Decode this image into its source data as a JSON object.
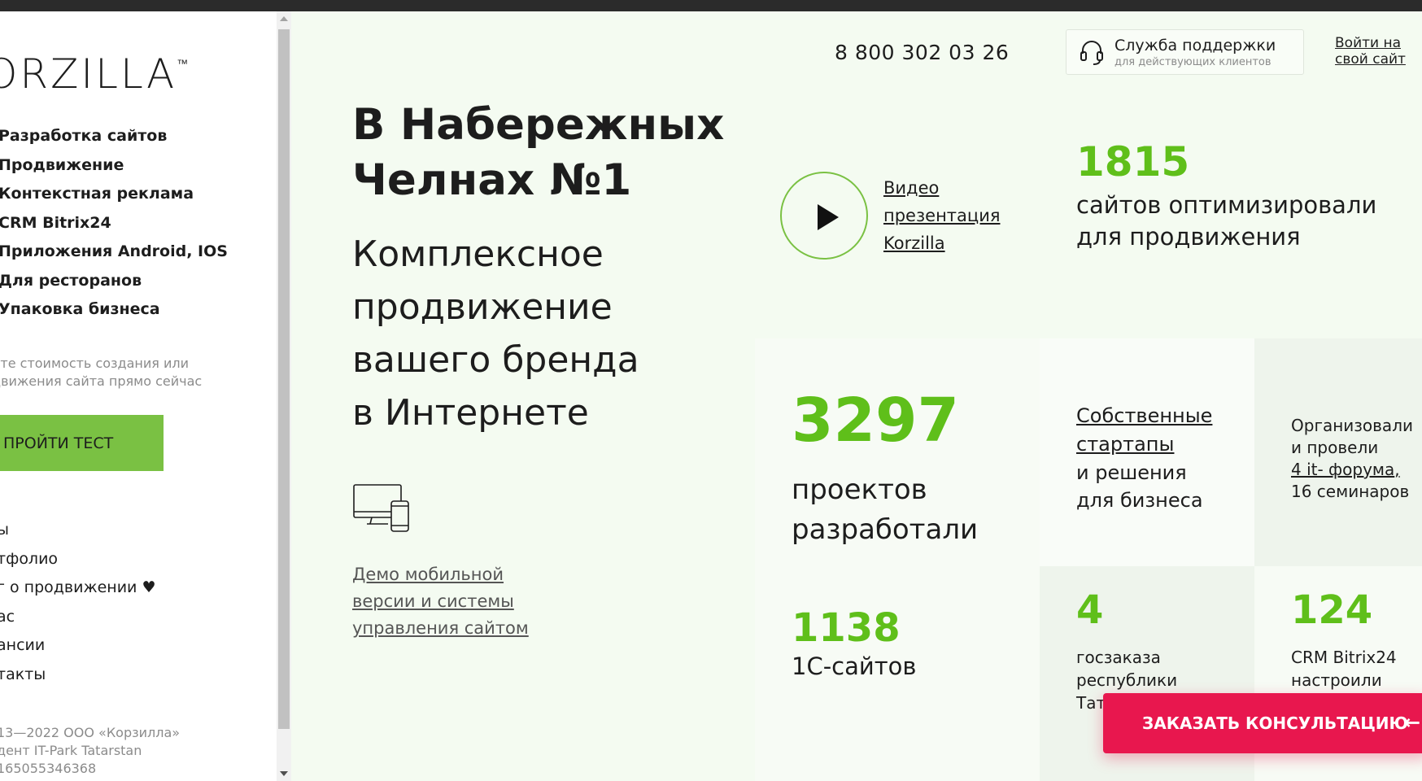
{
  "sidebar": {
    "logo": "ORZILLA",
    "logo_tm": "™",
    "menu": [
      "Разработка сайтов",
      "Продвижение",
      "Контекстная реклама",
      "CRM Bitrix24",
      "Приложения Android, IOS",
      "Для ресторанов",
      "Упаковка бизнеса"
    ],
    "promo_line1": "йте стоимость создания или",
    "promo_line2": "движения сайта прямо сейчас",
    "test_button": "ПРОЙТИ ТЕСТ",
    "menu2": [
      "ы",
      "тфолио",
      "г о продвижении ♥",
      "ас",
      "ансии",
      "такты"
    ],
    "footer_line1": "13—2022 ООО «Корзилла»",
    "footer_line2": "дент IT-Park Tatarstan",
    "footer_line3": "165055346368"
  },
  "header": {
    "phone": "8 800 302 03 26",
    "support_title": "Служба поддержки",
    "support_sub": "для действующих клиентов",
    "login_line1": "Войти на",
    "login_line2": "свой сайт"
  },
  "hero": {
    "headline_line1": "В Набережных",
    "headline_line2": "Челнах №1",
    "sub_line1": "Комплексное",
    "sub_line2": "продвижение",
    "sub_line3": "вашего бренда",
    "sub_line4": "в Интернете",
    "demo_line1": "Демо мобильной",
    "demo_line2": "версии и системы",
    "demo_line3": "управления сайтом",
    "video_line1": "Видео",
    "video_line2": "презентация",
    "video_line3": "Korzilla"
  },
  "stats": {
    "s1815_num": "1815",
    "s1815_line1": "сайтов оптимизировали",
    "s1815_line2": "для продвижения",
    "s3297_num": "3297",
    "s3297_line1": "проектов",
    "s3297_line2": "разработали",
    "s1138_num": "1138",
    "s1138_txt": "1С-сайтов",
    "startups_line1": "Собственные",
    "startups_line2": "стартапы",
    "startups_line3": "и решения",
    "startups_line4": "для бизнеса",
    "forum_line1": "Организовали",
    "forum_line2": "и провели",
    "forum_link": "4 it- форума",
    "forum_comma": ",",
    "forum_line4": "16 семинаров",
    "s4_num": "4",
    "s4_line1": "госзаказа",
    "s4_line2": "республики",
    "s4_line3": "Татарстан",
    "s124_num": "124",
    "s124_line1": "CRM Bitrix24",
    "s124_line2": "настроили"
  },
  "cta": {
    "consult": "ЗАКАЗАТЬ КОНСУЛЬТАЦИЮ",
    "arrow": "←"
  },
  "colors": {
    "accent_green": "#5fbf1a",
    "button_green": "#7ac143",
    "cta_red": "#e8174e",
    "page_bg": "#f4fbf1"
  },
  "icons": [
    "headset-icon",
    "play-icon",
    "devices-icon",
    "arrow-left-icon"
  ]
}
